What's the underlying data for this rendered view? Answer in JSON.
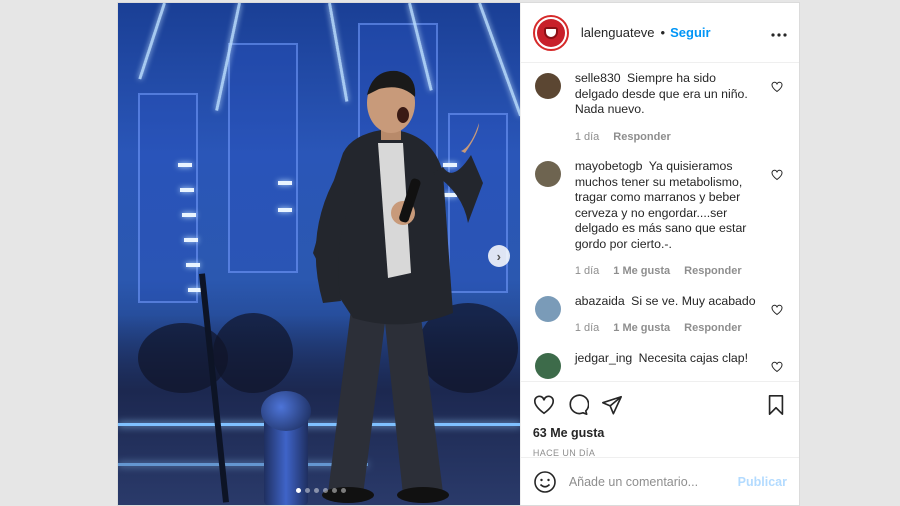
{
  "post": {
    "username": "lalenguateve",
    "separator": "•",
    "follow_label": "Seguir",
    "more_label": "•••",
    "next_icon": "chevron-right-icon",
    "carousel_dots": 6,
    "carousel_active": 1
  },
  "comments": [
    {
      "user": "selle830",
      "text": "Siempre ha sido delgado desde que era un niño. Nada nuevo.",
      "age": "1 día",
      "likes": "",
      "reply": "Responder",
      "avatar_color": "#5b4632"
    },
    {
      "user": "mayobetogb",
      "text": "Ya quisieramos muchos tener su metabolismo, tragar como marranos y beber cerveza y no engordar....ser delgado es más sano que estar gordo por cierto.-.",
      "age": "1 día",
      "likes": "1 Me gusta",
      "reply": "Responder",
      "avatar_color": "#6e6450"
    },
    {
      "user": "abazaida",
      "text": "Si se ve. Muy acabado",
      "age": "1 día",
      "likes": "1 Me gusta",
      "reply": "Responder",
      "avatar_color": "#7a9bb8"
    },
    {
      "user": "jedgar_ing",
      "text": "Necesita cajas clap!",
      "age": "",
      "likes": "",
      "reply": "",
      "avatar_color": "#3d6b4a"
    }
  ],
  "actions": {
    "likes": "63 Me gusta",
    "time": "HACE UN DÍA"
  },
  "add_comment": {
    "placeholder": "Añade un comentario...",
    "publish_label": "Publicar"
  },
  "colors": {
    "accent": "#0095f6",
    "publish_disabled": "#b3dbff",
    "avatar_red": "#c8202a"
  }
}
